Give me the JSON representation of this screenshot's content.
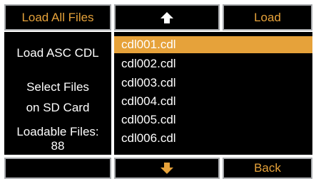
{
  "toolbar": {
    "load_all_label": "Load All Files",
    "up_icon": "arrow-up-icon",
    "load_label": "Load"
  },
  "info": {
    "title": "Load ASC CDL",
    "select_line1": "Select Files",
    "select_line2": "on SD Card",
    "loadable_label": "Loadable Files:",
    "loadable_count": "88"
  },
  "files": [
    {
      "name": "cdl001.cdl",
      "selected": true
    },
    {
      "name": "cdl002.cdl",
      "selected": false
    },
    {
      "name": "cdl003.cdl",
      "selected": false
    },
    {
      "name": "cdl004.cdl",
      "selected": false
    },
    {
      "name": "cdl005.cdl",
      "selected": false
    },
    {
      "name": "cdl006.cdl",
      "selected": false
    }
  ],
  "bottom": {
    "down_icon": "arrow-down-icon",
    "back_label": "Back"
  },
  "colors": {
    "accent": "#e6a23a",
    "background": "#000000",
    "frame": "#a7a9ac",
    "up_arrow": "#ffffff"
  }
}
